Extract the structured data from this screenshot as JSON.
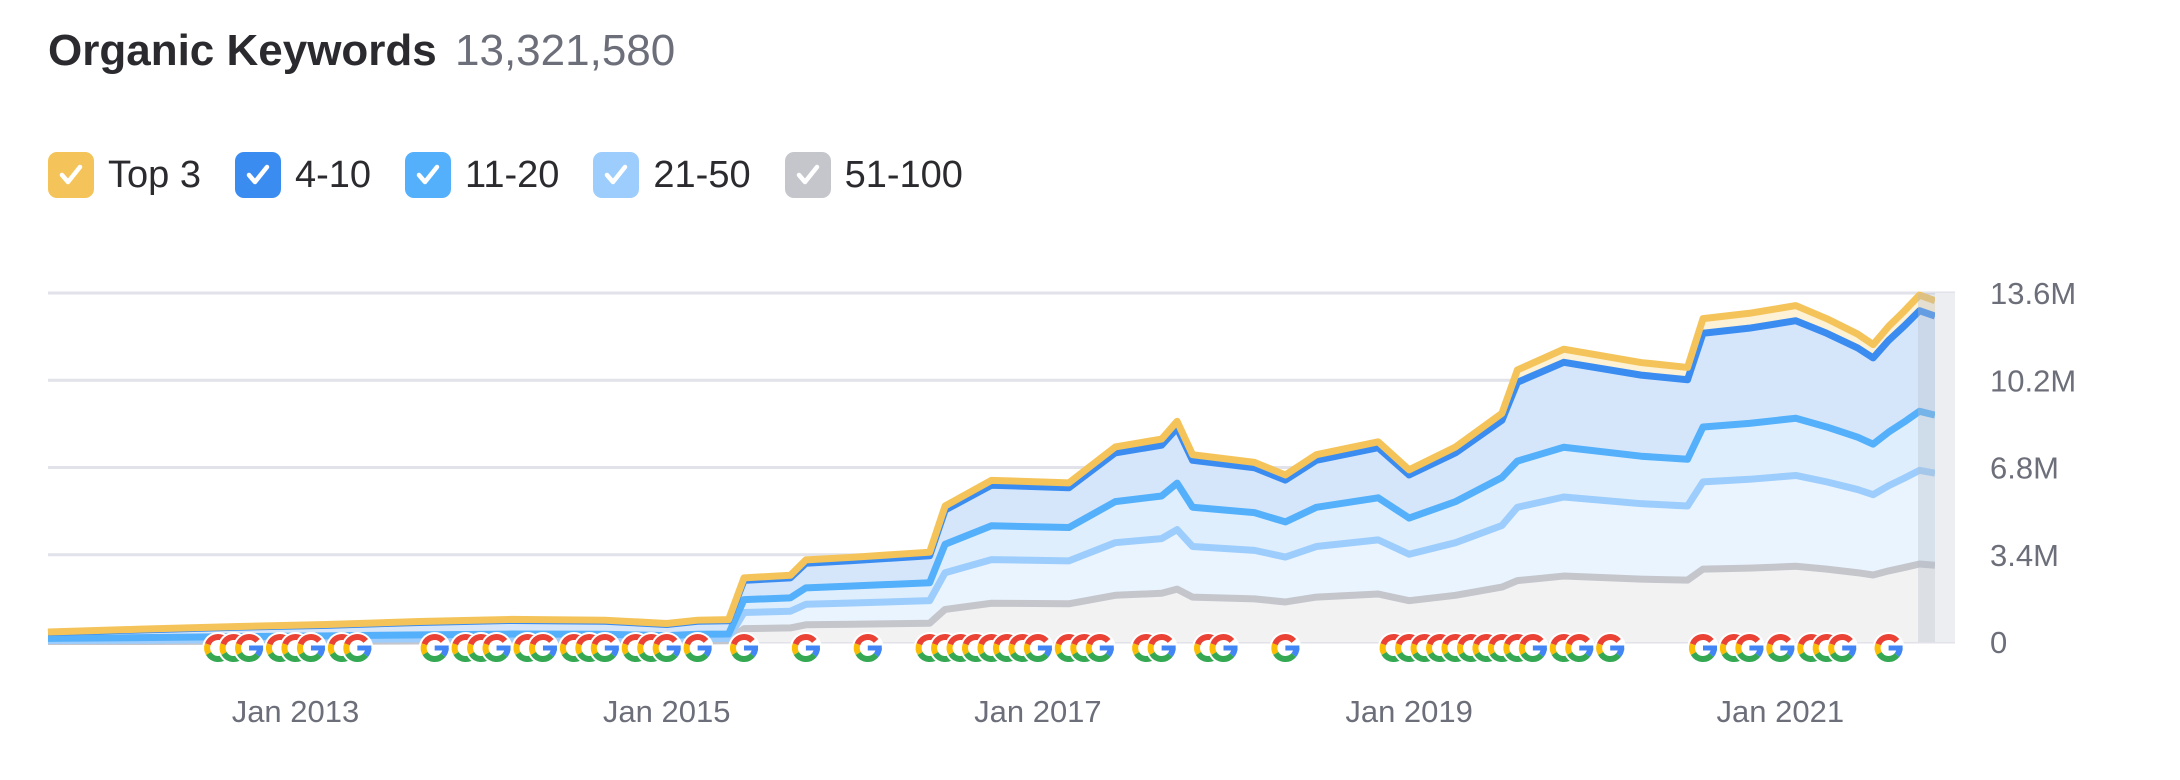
{
  "header": {
    "title": "Organic Keywords",
    "total": "13,321,580"
  },
  "legend": [
    {
      "label": "Top 3",
      "color": "#f4c45a",
      "checked": true
    },
    {
      "label": "4-10",
      "color": "#3b8cf0",
      "checked": true
    },
    {
      "label": "11-20",
      "color": "#54b0fb",
      "checked": true
    },
    {
      "label": "21-50",
      "color": "#9dcdfc",
      "checked": true
    },
    {
      "label": "51-100",
      "color": "#c4c6cc",
      "checked": true
    }
  ],
  "chart_data": {
    "type": "area",
    "stacked": true,
    "title": "",
    "xlabel": "",
    "ylabel": "",
    "unit": "M",
    "ylim": [
      0,
      13.6
    ],
    "yticks": [
      0,
      3.4,
      6.8,
      10.2,
      13.6
    ],
    "ytick_labels": [
      "0",
      "3.4M",
      "6.8M",
      "10.2M",
      "13.6M"
    ],
    "xlim": [
      "2011-09",
      "2021-11"
    ],
    "xticks": [
      "2013-01",
      "2015-01",
      "2017-01",
      "2019-01",
      "2021-01"
    ],
    "xtick_labels": [
      "Jan 2013",
      "Jan 2015",
      "Jan 2017",
      "Jan 2019",
      "Jan 2021"
    ],
    "grid": true,
    "legend_position": "top-left",
    "x": [
      "2011-09",
      "2012-03",
      "2012-09",
      "2013-03",
      "2013-09",
      "2014-03",
      "2014-09",
      "2015-01",
      "2015-03",
      "2015-05",
      "2015-06",
      "2015-09",
      "2015-10",
      "2016-01",
      "2016-06",
      "2016-07",
      "2016-10",
      "2017-03",
      "2017-06",
      "2017-09",
      "2017-10",
      "2017-11",
      "2018-03",
      "2018-05",
      "2018-07",
      "2018-11",
      "2019-01",
      "2019-04",
      "2019-07",
      "2019-08",
      "2019-11",
      "2020-04",
      "2020-07",
      "2020-08",
      "2020-11",
      "2021-02",
      "2021-04",
      "2021-06",
      "2021-07",
      "2021-08",
      "2021-09",
      "2021-10",
      "2021-11"
    ],
    "series": [
      {
        "name": "51-100",
        "color": "#c4c6cc",
        "fill": "#f2f2f3",
        "values": [
          0.02,
          0.02,
          0.03,
          0.03,
          0.04,
          0.04,
          0.04,
          0.04,
          0.04,
          0.05,
          0.52,
          0.55,
          0.67,
          0.69,
          0.73,
          1.27,
          1.51,
          1.49,
          1.82,
          1.9,
          2.06,
          1.75,
          1.68,
          1.56,
          1.75,
          1.87,
          1.61,
          1.82,
          2.14,
          2.39,
          2.57,
          2.45,
          2.41,
          2.84,
          2.88,
          2.95,
          2.84,
          2.7,
          2.61,
          2.77,
          2.9,
          3.04,
          2.99
        ]
      },
      {
        "name": "21-50",
        "color": "#9dcdfc",
        "fill": "#eaf4fe",
        "values": [
          0.04,
          0.05,
          0.06,
          0.07,
          0.08,
          0.09,
          0.09,
          0.07,
          0.09,
          0.09,
          0.63,
          0.65,
          0.8,
          0.83,
          0.88,
          1.43,
          1.7,
          1.67,
          2.05,
          2.13,
          2.32,
          1.97,
          1.89,
          1.75,
          1.97,
          2.11,
          1.81,
          2.05,
          2.4,
          2.86,
          3.08,
          2.94,
          2.89,
          3.4,
          3.46,
          3.54,
          3.4,
          3.24,
          3.13,
          3.32,
          3.48,
          3.65,
          3.59
        ]
      },
      {
        "name": "11-20",
        "color": "#54b0fb",
        "fill": "#deeefd",
        "values": [
          0.08,
          0.1,
          0.12,
          0.14,
          0.16,
          0.18,
          0.17,
          0.14,
          0.17,
          0.17,
          0.5,
          0.52,
          0.64,
          0.66,
          0.7,
          1.11,
          1.32,
          1.3,
          1.6,
          1.66,
          1.81,
          1.53,
          1.47,
          1.37,
          1.53,
          1.64,
          1.41,
          1.6,
          1.87,
          1.8,
          1.94,
          1.85,
          1.82,
          2.14,
          2.18,
          2.23,
          2.14,
          2.04,
          1.97,
          2.09,
          2.19,
          2.3,
          2.26
        ]
      },
      {
        "name": "4-10",
        "color": "#3b8cf0",
        "fill": "#d6e6fa",
        "values": [
          0.23,
          0.3,
          0.36,
          0.41,
          0.48,
          0.53,
          0.51,
          0.43,
          0.51,
          0.52,
          0.75,
          0.78,
          0.96,
          0.99,
          1.05,
          1.33,
          1.58,
          1.55,
          1.9,
          1.98,
          2.15,
          1.83,
          1.75,
          1.63,
          1.83,
          1.95,
          1.68,
          1.9,
          2.23,
          3.07,
          3.31,
          3.16,
          3.1,
          3.65,
          3.71,
          3.8,
          3.65,
          3.48,
          3.36,
          3.57,
          3.74,
          3.92,
          3.86
        ]
      },
      {
        "name": "Top 3",
        "color": "#f4c45a",
        "fill": "#fdf1d6",
        "values": [
          0.02,
          0.03,
          0.03,
          0.03,
          0.04,
          0.04,
          0.04,
          0.04,
          0.04,
          0.04,
          0.1,
          0.1,
          0.13,
          0.13,
          0.14,
          0.16,
          0.19,
          0.19,
          0.23,
          0.24,
          0.26,
          0.22,
          0.21,
          0.2,
          0.22,
          0.23,
          0.2,
          0.23,
          0.27,
          0.48,
          0.51,
          0.49,
          0.48,
          0.57,
          0.58,
          0.59,
          0.57,
          0.54,
          0.52,
          0.55,
          0.58,
          0.61,
          0.6
        ]
      }
    ],
    "update_markers": {
      "icon": "google-g-icon",
      "dates": [
        "2012-08",
        "2012-09",
        "2012-10",
        "2012-12",
        "2013-01",
        "2013-02",
        "2013-04",
        "2013-05",
        "2013-10",
        "2013-12",
        "2014-01",
        "2014-02",
        "2014-04",
        "2014-05",
        "2014-07",
        "2014-08",
        "2014-09",
        "2014-11",
        "2014-12",
        "2015-01",
        "2015-03",
        "2015-06",
        "2015-10",
        "2016-02",
        "2016-06",
        "2016-07",
        "2016-08",
        "2016-09",
        "2016-10",
        "2016-11",
        "2016-12",
        "2017-01",
        "2017-03",
        "2017-04",
        "2017-05",
        "2017-08",
        "2017-09",
        "2017-12",
        "2018-01",
        "2018-05",
        "2018-12",
        "2019-01",
        "2019-02",
        "2019-03",
        "2019-04",
        "2019-05",
        "2019-06",
        "2019-07",
        "2019-08",
        "2019-09",
        "2019-11",
        "2019-12",
        "2020-02",
        "2020-08",
        "2020-10",
        "2020-11",
        "2021-01",
        "2021-03",
        "2021-04",
        "2021-05",
        "2021-08"
      ]
    }
  }
}
